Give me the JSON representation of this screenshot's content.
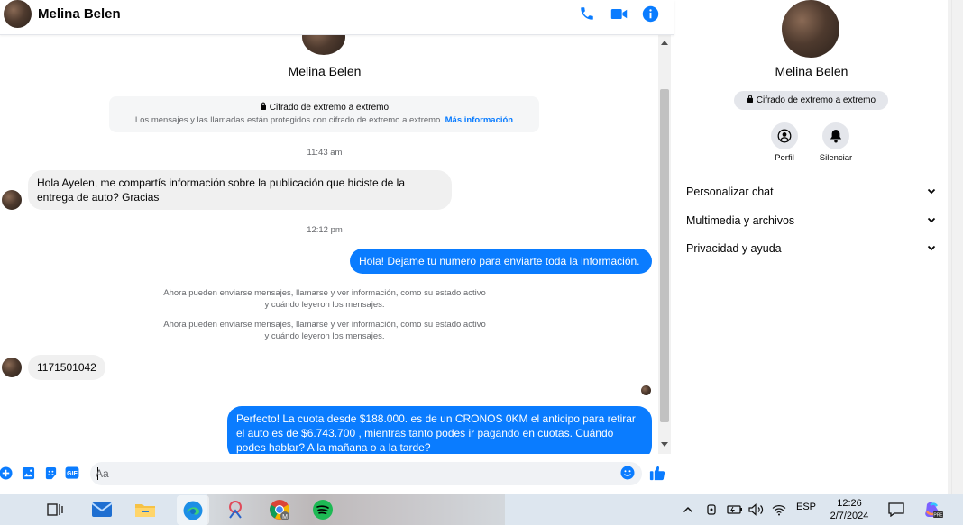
{
  "chat": {
    "header_name": "Melina Belen",
    "top_name": "Melina Belen",
    "e2e_title": "Cifrado de extremo a extremo",
    "e2e_desc": "Los mensajes y las llamadas están protegidos con cifrado de extremo a extremo.",
    "e2e_link": "Más información",
    "time1": "11:43 am",
    "msg1": "Hola Ayelen, me compartís información sobre la publicación que hiciste de la entrega de auto? Gracias",
    "time2": "12:12 pm",
    "msg2": "Hola! Dejame tu numero  para enviarte toda la información.",
    "sys1": "Ahora pueden enviarse mensajes, llamarse y ver información, como su estado activo y cuándo leyeron los mensajes.",
    "sys2": "Ahora pueden enviarse mensajes, llamarse y ver información, como su estado activo y cuándo leyeron los mensajes.",
    "msg3": "1171501042",
    "msg4": "Perfecto! La cuota desde $188.000. es de un CRONOS 0KM el anticipo para retirar el auto es de $6.743.700 , mientras tanto podes ir pagando en cuotas. Cuándo podes hablar? A la mañana o a la tarde?",
    "composer_placeholder": "Aa"
  },
  "info": {
    "name": "Melina Belen",
    "e2e_pill": "Cifrado de extremo a extremo",
    "profile_label": "Perfil",
    "mute_label": "Silenciar",
    "sections": [
      {
        "label": "Personalizar chat"
      },
      {
        "label": "Multimedia y archivos"
      },
      {
        "label": "Privacidad y ayuda"
      }
    ]
  },
  "icons": {
    "header": [
      "phone-icon",
      "video-icon",
      "info-icon"
    ],
    "composer": [
      "plus-icon",
      "image-icon",
      "sticker-icon",
      "gif-icon",
      "emoji-icon",
      "like-icon"
    ]
  },
  "taskbar": {
    "lang": "ESP",
    "time": "12:26",
    "date": "2/7/2024"
  },
  "colors": {
    "accent": "#0a7cff",
    "bubble_in": "#f0f0f0"
  }
}
